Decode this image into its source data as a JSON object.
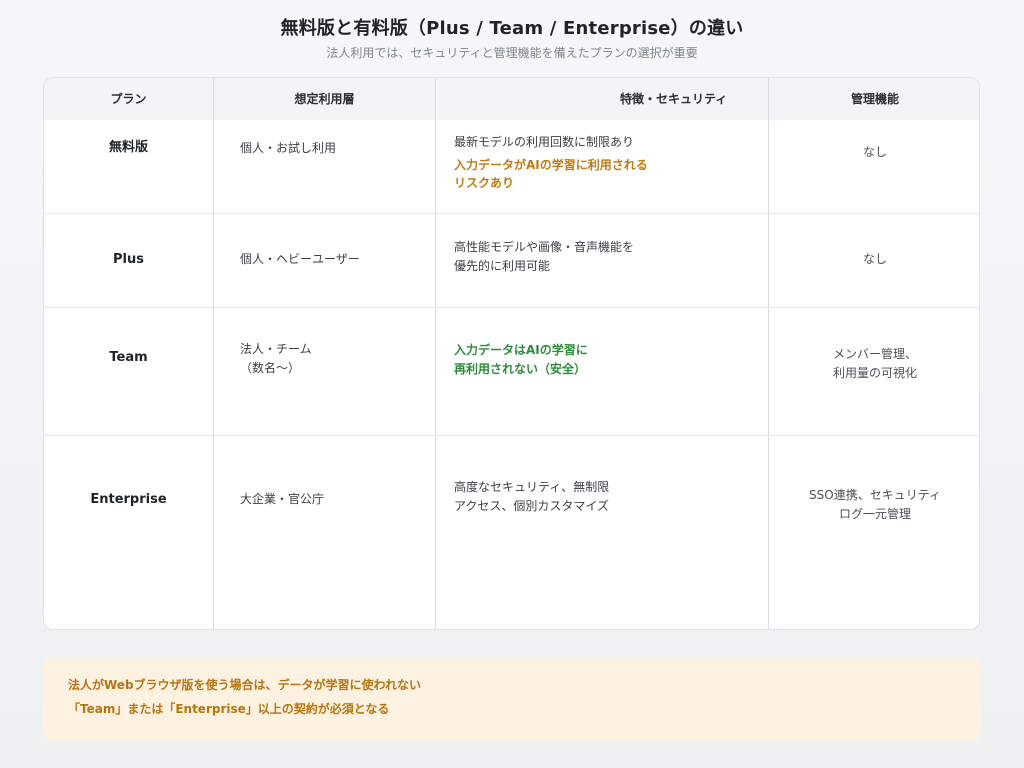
{
  "header": {
    "title": "無料版と有料版（Plus / Team / Enterprise）の違い",
    "subtitle": "法人利用では、セキュリティと管理機能を備えたプランの選択が重要"
  },
  "table": {
    "columns": [
      "プラン",
      "想定利用層",
      "特徴・セキュリティ",
      "管理機能"
    ],
    "rows": [
      {
        "plan": "無料版",
        "user": [
          "個人・お試し利用"
        ],
        "features": [
          "最新モデルの利用回数に制限あり"
        ],
        "features_highlight": [
          "入力データがAIの学習に利用される",
          "リスクあり"
        ],
        "management": [
          "なし"
        ]
      },
      {
        "plan": "Plus",
        "user": [
          "個人・ヘビーユーザー"
        ],
        "features": [
          "高性能モデルや画像・音声機能を",
          "優先的に利用可能"
        ],
        "features_highlight": [],
        "management": [
          "なし"
        ]
      },
      {
        "plan": "Team",
        "user": [
          "法人・チーム",
          "（数名〜）"
        ],
        "features": [],
        "features_highlight": [
          "入力データはAIの学習に",
          "再利用されない（安全）"
        ],
        "management": [
          "メンバー管理、",
          "利用量の可視化"
        ]
      },
      {
        "plan": "Enterprise",
        "user": [
          "大企業・官公庁"
        ],
        "features": [
          "高度なセキュリティ、無制限",
          "アクセス、個別カスタマイズ"
        ],
        "features_highlight": [],
        "management": [
          "SSO連携、セキュリティ",
          "ログ一元管理"
        ]
      }
    ]
  },
  "notice": {
    "line1": "法人がWebブラウザ版を使う場合は、データが学習に使われない",
    "line2": "「Team」または「Enterprise」以上の契約が必須となる"
  },
  "colors": {
    "warning": "#c27a12",
    "safe": "#2e8b3d",
    "notice_bg": "#fdf2e2"
  }
}
